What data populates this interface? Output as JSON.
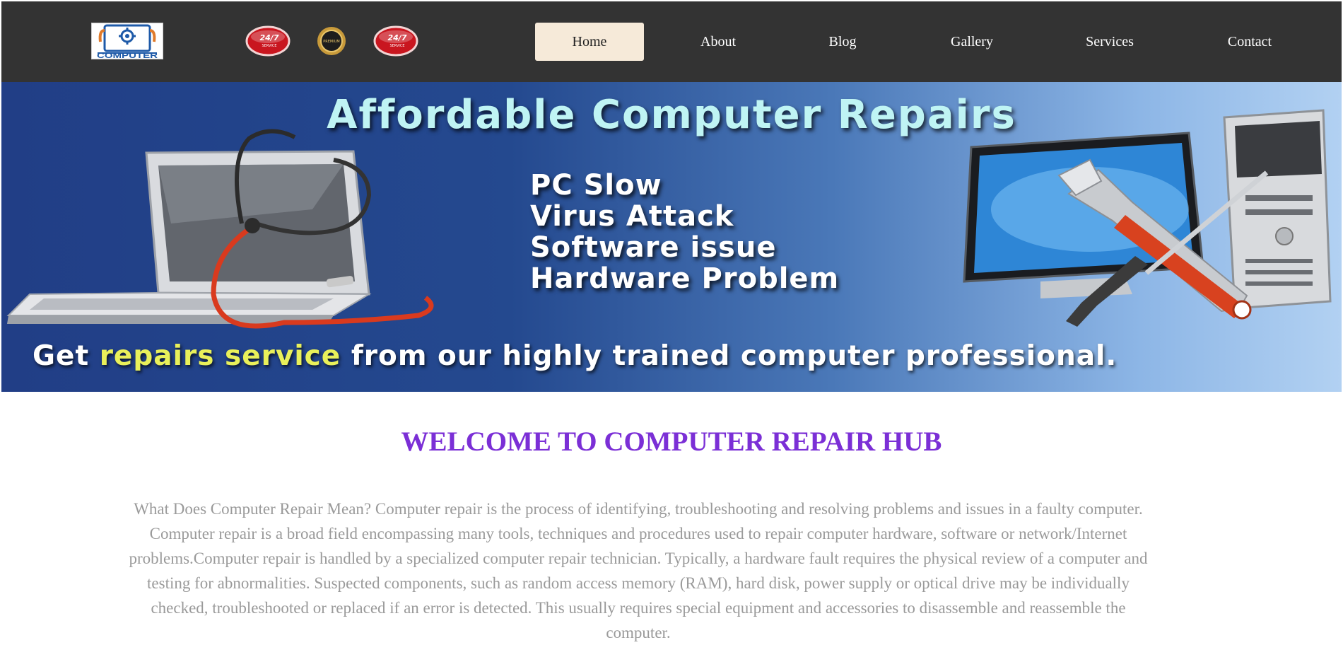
{
  "header": {
    "logo_text": "COMPUTER",
    "badges": [
      {
        "icon": "service-24-7-badge-icon",
        "text": "24/7",
        "subtext": "SERVICE"
      },
      {
        "icon": "premium-badge-icon",
        "text": "PREMIUM"
      },
      {
        "icon": "service-24-7-badge-icon",
        "text": "24/7",
        "subtext": "SERVICE"
      }
    ],
    "nav": [
      {
        "label": "Home",
        "active": true
      },
      {
        "label": "About"
      },
      {
        "label": "Blog"
      },
      {
        "label": "Gallery"
      },
      {
        "label": "Services"
      },
      {
        "label": "Contact"
      }
    ]
  },
  "hero": {
    "title": "Affordable Computer Repairs",
    "problems": [
      "PC Slow",
      "Virus Attack",
      "Software issue",
      "Hardware Problem"
    ],
    "tagline_prefix": "Get",
    "tagline_highlight": "repairs service",
    "tagline_suffix": "from our highly trained computer professional."
  },
  "main": {
    "heading": "WELCOME TO COMPUTER REPAIR HUB",
    "intro": "What Does Computer Repair Mean? Computer repair is the process of identifying, troubleshooting and resolving problems and issues in a faulty computer. Computer repair is a broad field encompassing many tools, techniques and procedures used to repair computer hardware, software or network/Internet problems.Computer repair is handled by a specialized computer repair technician. Typically, a hardware fault requires the physical review of a computer and testing for abnormalities. Suspected components, such as random access memory (RAM), hard disk, power supply or optical drive may be individually checked, troubleshooted or replaced if an error is detected. This usually requires special equipment and accessories to disassemble and reassemble the computer."
  },
  "colors": {
    "header_bg": "#333333",
    "nav_active_bg": "#f6ead9",
    "heading": "#7b2fd6",
    "body_text": "#9a9a9a",
    "hero_title": "#bff4f4",
    "tagline_highlight": "#e9f05a"
  }
}
